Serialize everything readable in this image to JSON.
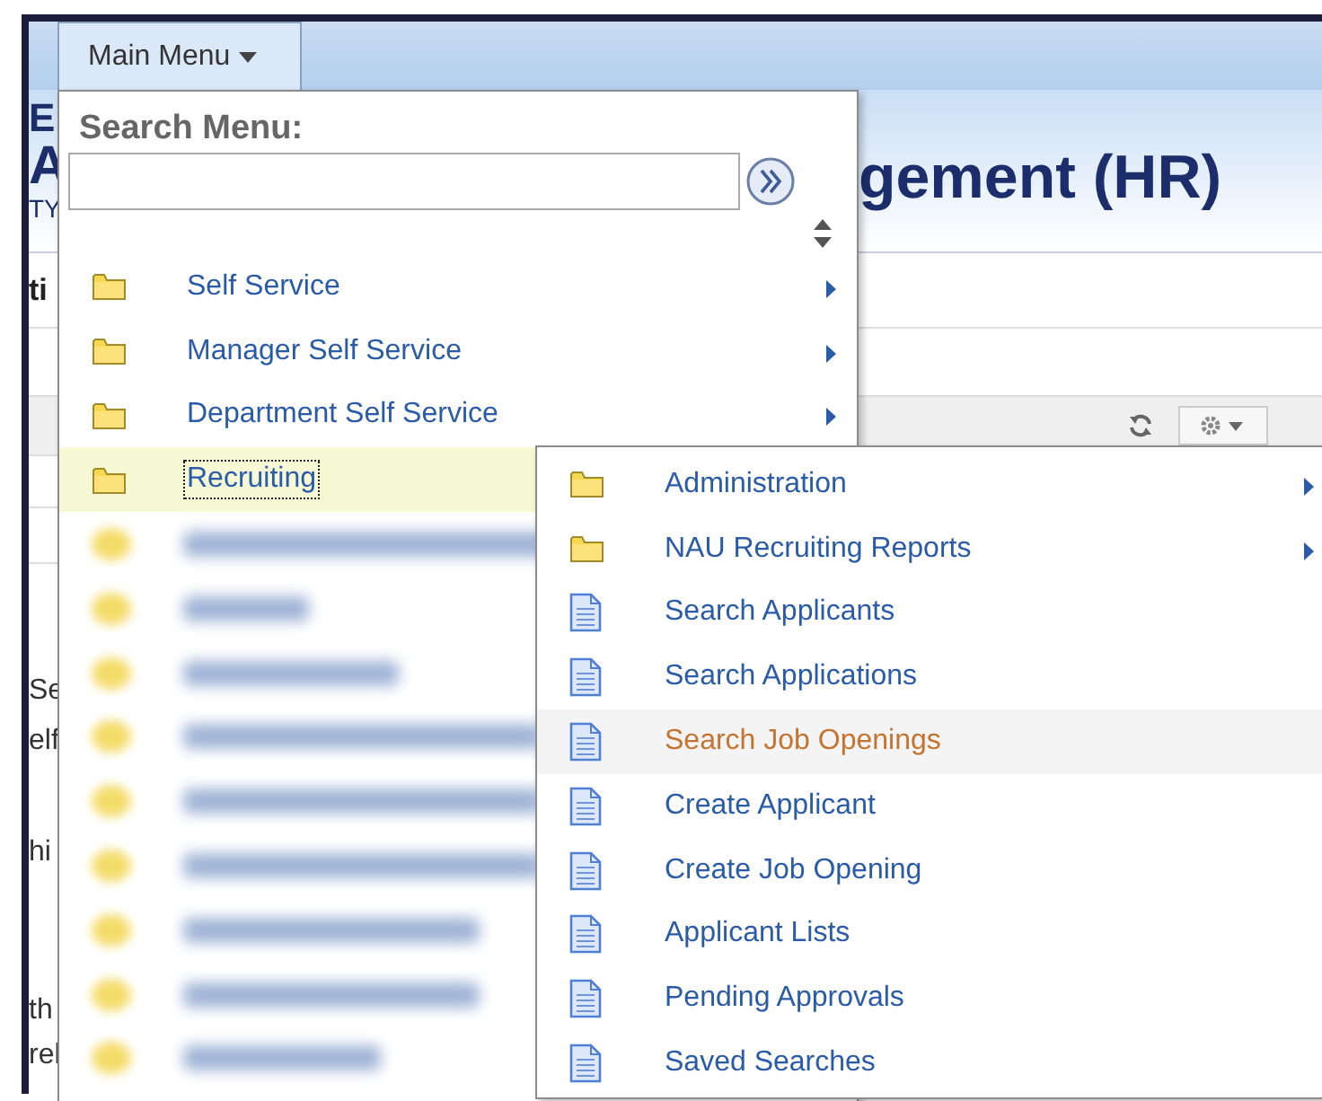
{
  "main_menu_button": {
    "label": "Main Menu",
    "expanded": true
  },
  "background_page": {
    "header_letters": [
      "E",
      "A",
      "TY"
    ],
    "title": "gement (HR)",
    "section_fragment": "ti",
    "left_fragments": [
      "Se",
      "elf",
      "hi",
      "th",
      "rel"
    ]
  },
  "search_menu": {
    "label": "Search Menu:"
  },
  "main_menu": {
    "items": [
      {
        "kind": "folder",
        "label": "Self Service",
        "has_submenu": true,
        "selected": false
      },
      {
        "kind": "folder",
        "label": "Manager Self Service",
        "has_submenu": true,
        "selected": false
      },
      {
        "kind": "folder",
        "label": "Department Self Service",
        "has_submenu": true,
        "selected": false
      },
      {
        "kind": "folder",
        "label": "Recruiting",
        "has_submenu": false,
        "selected": true
      },
      {
        "kind": "blurred"
      },
      {
        "kind": "blurred"
      },
      {
        "kind": "blurred"
      },
      {
        "kind": "blurred"
      },
      {
        "kind": "blurred"
      },
      {
        "kind": "blurred"
      },
      {
        "kind": "blurred"
      },
      {
        "kind": "blurred"
      },
      {
        "kind": "blurred"
      }
    ]
  },
  "submenu": {
    "items": [
      {
        "kind": "folder",
        "label": "Administration",
        "has_submenu": true,
        "selected": false
      },
      {
        "kind": "folder",
        "label": "NAU Recruiting Reports",
        "has_submenu": true,
        "selected": false
      },
      {
        "kind": "page",
        "label": "Search Applicants",
        "has_submenu": false,
        "selected": false
      },
      {
        "kind": "page",
        "label": "Search Applications",
        "has_submenu": false,
        "selected": false
      },
      {
        "kind": "page",
        "label": "Search Job Openings",
        "has_submenu": false,
        "selected": true
      },
      {
        "kind": "page",
        "label": "Create Applicant",
        "has_submenu": false,
        "selected": false
      },
      {
        "kind": "page",
        "label": "Create Job Opening",
        "has_submenu": false,
        "selected": false
      },
      {
        "kind": "page",
        "label": "Applicant Lists",
        "has_submenu": false,
        "selected": false
      },
      {
        "kind": "page",
        "label": "Pending Approvals",
        "has_submenu": false,
        "selected": false
      },
      {
        "kind": "page",
        "label": "Saved Searches",
        "has_submenu": false,
        "selected": false
      }
    ]
  }
}
